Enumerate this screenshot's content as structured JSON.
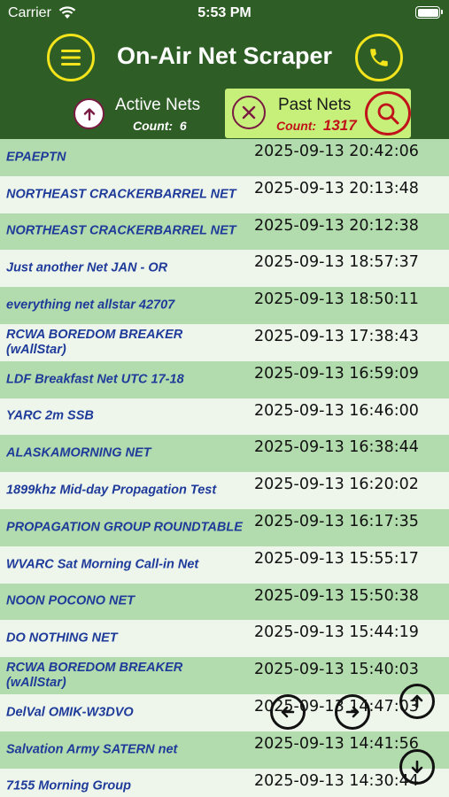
{
  "status": {
    "carrier": "Carrier",
    "time": "5:53 PM"
  },
  "header": {
    "title": "On-Air Net Scraper"
  },
  "tabs": {
    "active": {
      "label": "Active Nets",
      "count_label": "Count:",
      "count": "6"
    },
    "past": {
      "label": "Past Nets",
      "count_label": "Count:",
      "count": "1317"
    }
  },
  "colors": {
    "header_bg": "#2e5e26",
    "accent_yellow": "#f3e41c",
    "selected_tab": "#c6f07a",
    "row_odd": "#b3dcae",
    "row_even": "#eef6ec",
    "name_blue": "#1f3b9a",
    "count_red": "#c0141a"
  },
  "icons": {
    "menu": "hamburger-icon",
    "phone": "phone-icon",
    "active": "arrow-up-circle-icon",
    "close": "close-icon",
    "search": "search-icon",
    "prev": "arrow-left-icon",
    "next": "arrow-right-icon",
    "up": "arrow-up-icon",
    "down": "arrow-down-icon"
  },
  "nets": [
    {
      "name": "EPAEPTN",
      "date": "2025-09-13 20:42:06"
    },
    {
      "name": "NORTHEAST CRACKERBARREL NET",
      "date": "2025-09-13 20:13:48"
    },
    {
      "name": "NORTHEAST CRACKERBARREL NET",
      "date": "2025-09-13 20:12:38"
    },
    {
      "name": "Just another Net JAN - OR",
      "date": "2025-09-13 18:57:37"
    },
    {
      "name": "everything net allstar 42707",
      "date": "2025-09-13 18:50:11"
    },
    {
      "name": "RCWA BOREDOM BREAKER (wAllStar)",
      "date": "2025-09-13 17:38:43"
    },
    {
      "name": "LDF Breakfast Net UTC 17-18",
      "date": "2025-09-13 16:59:09"
    },
    {
      "name": "YARC 2m SSB",
      "date": "2025-09-13 16:46:00"
    },
    {
      "name": "ALASKAMORNING NET",
      "date": "2025-09-13 16:38:44"
    },
    {
      "name": "1899khz Mid-day Propagation Test",
      "date": "2025-09-13 16:20:02"
    },
    {
      "name": "PROPAGATION GROUP ROUNDTABLE",
      "date": "2025-09-13 16:17:35"
    },
    {
      "name": "WVARC Sat Morning Call-in Net",
      "date": "2025-09-13 15:55:17"
    },
    {
      "name": "NOON POCONO NET",
      "date": "2025-09-13 15:50:38"
    },
    {
      "name": "DO NOTHING NET",
      "date": "2025-09-13 15:44:19"
    },
    {
      "name": "RCWA BOREDOM BREAKER (wAllStar)",
      "date": "2025-09-13 15:40:03"
    },
    {
      "name": "DelVal OMIK-W3DVO",
      "date": "2025-09-13 14:47:03"
    },
    {
      "name": "Salvation Army SATERN net",
      "date": "2025-09-13 14:41:56"
    },
    {
      "name": "7155 Morning Group",
      "date": "2025-09-13 14:30:44"
    }
  ]
}
